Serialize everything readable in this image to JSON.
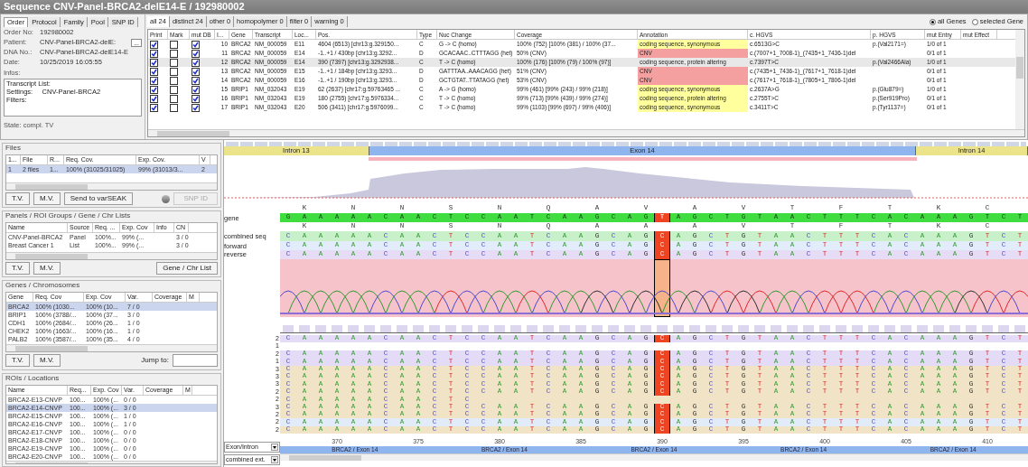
{
  "window": {
    "title": "Sequence CNV-Panel-BRCA2-delE14-E / 192980002"
  },
  "order_panel": {
    "tabs": [
      {
        "label": "Order",
        "selected": true
      },
      {
        "label": "Protocol",
        "selected": false
      },
      {
        "label": "Family",
        "selected": false
      },
      {
        "label": "Pool",
        "selected": false
      },
      {
        "label": "SNP ID",
        "selected": false
      }
    ],
    "fields": [
      {
        "label": "Order No:",
        "value": "192980002"
      },
      {
        "label": "Patient:",
        "value": "CNV-Panel-BRCA2-delE:",
        "button": "..."
      },
      {
        "label": "DNA No.:",
        "value": "CNV-Panel-BRCA2-delE14-E"
      },
      {
        "label": "Date:",
        "value": "10/25/2019 16:05:55"
      }
    ],
    "infos_label": "Infos:",
    "infos_lines": [
      "Transcript List:",
      "Settings:     CNV-Panel-BRCA2",
      "Filters:"
    ],
    "state": "State:  compl. TV"
  },
  "variant_tabs": [
    {
      "label": "all 24",
      "selected": true
    },
    {
      "label": "distinct 24",
      "selected": false
    },
    {
      "label": "other 0",
      "selected": false
    },
    {
      "label": "homopolymer 0",
      "selected": false
    },
    {
      "label": "filter 0",
      "selected": false
    },
    {
      "label": "warning 0",
      "selected": false
    }
  ],
  "gene_filter": [
    {
      "label": "all Genes",
      "selected": true
    },
    {
      "label": "selected Gene",
      "selected": false
    }
  ],
  "variant_table": {
    "columns": [
      "Print",
      "Mark",
      "mut DB",
      "I...",
      "Gene",
      "Transcript",
      "Loc...",
      "Pos.",
      "Type",
      "Nuc Change",
      "Coverage",
      "Annotation",
      "c. HGVS",
      "p. HGVS",
      "mut Entry",
      "mut Effect"
    ],
    "rows": [
      {
        "print": true,
        "mark": false,
        "mut_db": true,
        "index": "10",
        "gene": "BRCA2",
        "transcript": "NM_000059",
        "loc": "E11",
        "pos": "4604 (6513)  [chr13:g.329150...",
        "type": "C",
        "nuc_change": "G -> C (homo)",
        "coverage": "100% (752)  [100% (381) / 100% (37...",
        "annotation": {
          "text": "coding sequence, synonymous",
          "color": "#ffff9e"
        },
        "c_hgvs": "c.6513G>C",
        "p_hgvs": "p.(Val2171=)",
        "mut_entry": "1/0 of 1",
        "selected": false
      },
      {
        "print": true,
        "mark": false,
        "mut_db": true,
        "index": "11",
        "gene": "BRCA2",
        "transcript": "NM_000059",
        "loc": "E14",
        "pos": "-1..+1 / 430bp  [chr13:g.3292...",
        "type": "D",
        "nuc_change": "GCACAAC..CTTTAGG (het)",
        "coverage": "50% (CNV)",
        "annotation": {
          "text": "CNV",
          "color": "#f4a0a0"
        },
        "c_hgvs": "c.(7007+1_7008-1)_(7435+1_7436-1)del",
        "mut_entry": "0/1 of 1",
        "selected": false
      },
      {
        "print": true,
        "mark": false,
        "mut_db": true,
        "index": "12",
        "gene": "BRCA2",
        "transcript": "NM_000059",
        "loc": "E14",
        "pos": "390 (7397)  [chr13:g.3292938...",
        "type": "C",
        "nuc_change": "T -> C (homo)",
        "coverage": "100% (176)  [100% (79) / 100% (97)]",
        "annotation": {
          "text": "coding sequence, protein altering"
        },
        "c_hgvs": "c.7397T>C",
        "p_hgvs": "p.(Val2466Ala)",
        "mut_entry": "1/0 of 1",
        "selected": true
      },
      {
        "print": true,
        "mark": false,
        "mut_db": true,
        "index": "13",
        "gene": "BRCA2",
        "transcript": "NM_000059",
        "loc": "E15",
        "pos": "-1..+1 / 184bp  [chr13:g.3293...",
        "type": "D",
        "nuc_change": "GATTTAA..AAACAGG (het)",
        "coverage": "51% (CNV)",
        "annotation": {
          "text": "CNV",
          "color": "#f4a0a0"
        },
        "c_hgvs": "c.(7435+1_7436-1)_(7617+1_7618-1)del",
        "mut_entry": "0/1 of 1",
        "selected": false
      },
      {
        "print": true,
        "mark": false,
        "mut_db": true,
        "index": "14",
        "gene": "BRCA2",
        "transcript": "NM_000059",
        "loc": "E16",
        "pos": "-1..+1 / 190bp  [chr13:g.3293...",
        "type": "D",
        "nuc_change": "GCTGTAT..TTATAGG (het)",
        "coverage": "53% (CNV)",
        "annotation": {
          "text": "CNV",
          "color": "#f4a0a0"
        },
        "c_hgvs": "c.(7617+1_7618-1)_(7805+1_7806-1)del",
        "mut_entry": "0/1 of 1",
        "selected": false
      },
      {
        "print": true,
        "mark": false,
        "mut_db": true,
        "index": "15",
        "gene": "BRIP1",
        "transcript": "NM_032043",
        "loc": "E19",
        "pos": "62 (2637)  [chr17:g.59763465 ...",
        "type": "C",
        "nuc_change": "A -> G (homo)",
        "coverage": "99% (461)  [99% (243) / 99% (218)]",
        "annotation": {
          "text": "coding sequence, synonymous",
          "color": "#ffff9e"
        },
        "c_hgvs": "c.2637A>G",
        "p_hgvs": "p.(Glu879=)",
        "mut_entry": "1/0 of 1",
        "selected": false
      },
      {
        "print": true,
        "mark": false,
        "mut_db": true,
        "index": "16",
        "gene": "BRIP1",
        "transcript": "NM_032043",
        "loc": "E19",
        "pos": "180 (2755)  [chr17:g.5976334...",
        "type": "C",
        "nuc_change": "T -> C (homo)",
        "coverage": "99% (713)  [99% (439) / 99% (274)]",
        "annotation": {
          "text": "coding sequence, protein altering",
          "color": "#ffff9e"
        },
        "c_hgvs": "c.2755T>C",
        "p_hgvs": "p.(Ser919Pro)",
        "mut_entry": "0/1 of 1",
        "selected": false
      },
      {
        "print": true,
        "mark": false,
        "mut_db": true,
        "index": "17",
        "gene": "BRIP1",
        "transcript": "NM_032043",
        "loc": "E20",
        "pos": "506 (3411)  [chr17:g.5976099...",
        "type": "C",
        "nuc_change": "T -> C (homo)",
        "coverage": "99% (1103)  [99% (697) / 99% (406)]",
        "annotation": {
          "text": "coding sequence, synonymous",
          "color": "#ffff9e"
        },
        "c_hgvs": "c.3411T>C",
        "p_hgvs": "p.(Tyr1137=)",
        "mut_entry": "0/1 of 1",
        "selected": false
      }
    ]
  },
  "files": {
    "title": "Files",
    "columns": [
      "1...",
      "File",
      "R...",
      "Req. Cov.",
      "Exp. Cov.",
      "V"
    ],
    "rows": [
      {
        "cells": [
          "1",
          "2 files",
          "1...",
          "100% (31025/31025)",
          "99% (31013/3...",
          "2"
        ],
        "selected": true
      }
    ],
    "buttons": [
      "T.V.",
      "M.V.",
      "Send to varSEAK"
    ],
    "snp_button": {
      "label": "SNP ID",
      "disabled": true
    }
  },
  "panels": {
    "title": "Panels / ROI Groups / Gene / Chr Lists",
    "columns": [
      "Name",
      "Source",
      "Req. ...",
      "Exp. Cov",
      "Info",
      "CN"
    ],
    "rows": [
      {
        "cells": [
          "CNV-Panel-BRCA2",
          "Panel",
          "100%...",
          "99% (...",
          "",
          "3 / 0"
        ],
        "selected": false
      },
      {
        "cells": [
          "Breast Cancer 1",
          "List",
          "100%...",
          "99% (...",
          "",
          "3 / 0"
        ],
        "selected": false
      }
    ],
    "buttons": [
      "T.V.",
      "M.V."
    ],
    "right_button": "Gene / Chr List"
  },
  "genes": {
    "title": "Genes / Chromosomes",
    "columns": [
      "Gene",
      "Req. Cov",
      "Exp. Cov",
      "Var.",
      "Coverage",
      "M"
    ],
    "rows": [
      {
        "cells": [
          "BRCA2",
          "100% (1030...",
          "100% (10...",
          "7 / 0"
        ],
        "selected": true
      },
      {
        "cells": [
          "BRIP1",
          "100% (3788/...",
          "100% (37...",
          "3 / 0"
        ],
        "selected": false
      },
      {
        "cells": [
          "CDH1",
          "100% (2684/...",
          "100% (26...",
          "1 / 0"
        ],
        "selected": false
      },
      {
        "cells": [
          "CHEK2",
          "100% (1663/...",
          "100% (16...",
          "1 / 0"
        ],
        "selected": false
      },
      {
        "cells": [
          "PALB2",
          "100% (3587/...",
          "100% (35...",
          "4 / 0"
        ],
        "selected": false
      }
    ],
    "buttons": [
      "T.V.",
      "M.V."
    ],
    "jump_label": "Jump to:"
  },
  "rois": {
    "title": "ROIs / Locations",
    "columns": [
      "Name",
      "Req...",
      "Exp. Cov",
      "Var.",
      "Coverage",
      "M"
    ],
    "rows": [
      {
        "cells": [
          "BRCA2-E13-CNVP",
          "100...",
          "100% (...",
          "0 / 0"
        ],
        "selected": false
      },
      {
        "cells": [
          "BRCA2-E14-CNVP",
          "100...",
          "100% (...",
          "3 / 0"
        ],
        "selected": true
      },
      {
        "cells": [
          "BRCA2-E15-CNVP",
          "100...",
          "100% (...",
          "1 / 0"
        ],
        "selected": false
      },
      {
        "cells": [
          "BRCA2-E16-CNVP",
          "100...",
          "100% (...",
          "1 / 0"
        ],
        "selected": false
      },
      {
        "cells": [
          "BRCA2-E17-CNVP",
          "100...",
          "100% (...",
          "0 / 0"
        ],
        "selected": false
      },
      {
        "cells": [
          "BRCA2-E18-CNVP",
          "100...",
          "100% (...",
          "0 / 0"
        ],
        "selected": false
      },
      {
        "cells": [
          "BRCA2-E19-CNVP",
          "100...",
          "100% (...",
          "0 / 0"
        ],
        "selected": false
      },
      {
        "cells": [
          "BRCA2-E20-CNVP",
          "100...",
          "100% (...",
          "0 / 0"
        ],
        "selected": false
      }
    ]
  },
  "overview": {
    "regions": [
      {
        "label": "Intron 13",
        "kind": "intron"
      },
      {
        "label": "Exon 14",
        "kind": "exon"
      },
      {
        "label": "Intron 14",
        "kind": "intron"
      }
    ]
  },
  "sequence": {
    "labels": [
      "gene",
      "combined seq",
      "forward",
      "reverse"
    ],
    "gene_protein": [
      "K",
      "N",
      "N",
      "S",
      "N",
      "Q",
      "A",
      "V",
      "A",
      "V",
      "T",
      "F",
      "T",
      "K",
      "C"
    ],
    "combined_protein": [
      "K",
      "N",
      "N",
      "S",
      "N",
      "Q",
      "A",
      "A",
      "A",
      "V",
      "T",
      "F",
      "T",
      "K",
      "C"
    ],
    "gene": {
      "before": "G A A A A A C A A C T C C A A T C A A G C A G",
      "variant": "T",
      "after": "A G C T G T A A C T T T C A C A A A G T C T"
    },
    "combined": {
      "before": "C A A A A A C A A C T C C A A T C A A G C A G",
      "variant": "C",
      "after": "A G C T G T A A C T T T C A C A A A G T C T"
    },
    "forward": {
      "before": "C A A A A A C A A C T C C A A T C A A G C A G",
      "variant": "C",
      "after": "A G C T G T A A C T T T C A C A A A G T C T"
    },
    "reverse": {
      "before": "C A A A A A C A A C T C C A A T C A A G C A G",
      "variant": "C",
      "after": "A G C T G T A A C T T T C A C A A A G T C T"
    },
    "reads": [
      {
        "count": "2",
        "color": "#e4dcf6",
        "before": "C A A A A A C A A C T C C A A T C A A G C A G",
        "variant": "C",
        "after": "A G C T G T A A C T T T C A C A A A G T C T"
      },
      {
        "count": "1"
      },
      {
        "count": "2",
        "color": "#e4dcf6",
        "before": "C A A A A A C A A C T C C A A T C A A G C A G",
        "variant": "C",
        "after": "A G C T G T A A C T T T C A C A A A G T C T"
      },
      {
        "count": "1",
        "color": "#e4dcf6",
        "before": "C A A A A A C A A C T C C A A T C A A G C A G",
        "variant": "C",
        "after": "A G C T G T A A C T T T C A C A A A G T C T"
      },
      {
        "count": "3",
        "color": "#f1e4c6",
        "before": "C A A A A A C A A C T C C A A T C A A G C A G",
        "variant": "C",
        "after": "A G C T G T A A C T T T C A C A A A G T C T"
      },
      {
        "count": "3",
        "color": "#f1e4c6",
        "before": "C A A A A A C A A C T C C A A T C A A G C A G",
        "variant": "C",
        "after": "A G C T G T A A C T T T C A C A A A G T C T"
      },
      {
        "count": "3",
        "color": "#f1e4c6",
        "before": "C A A A A A C A A C T C C A A T C A A G C A G",
        "variant": "C",
        "after": "A G C T G T A A C T T T C A C A A A G T C T"
      },
      {
        "count": "2",
        "color": "#f1e4c6",
        "before": "C A A A A A C A A C T C C A A T C A A G C A G",
        "variant": "C",
        "after": "A G C T G T A A C T T T C A C A A A G T C T"
      },
      {
        "count": "2",
        "color": "#f1e4c6",
        "before": "C A A A A A C A A C T C"
      },
      {
        "count": "3",
        "color": "#f1e4c6",
        "before": "C A A A A A C A A C T C C A A T C A A G C A G",
        "variant": "C",
        "after": "A G C T G T A A C T T T C A C A A A G T C T"
      },
      {
        "count": "2",
        "color": "#f1e4c6",
        "before": "C A A A A A C A A C T C C A A T C A A G C A G",
        "variant": "C",
        "after": "A G C T G T A A C T T T C A C A A A G T C T"
      },
      {
        "count": "2",
        "color": "#e2ecf8",
        "before": "C A A A A A C A A C T C C A A T C A A G C A G",
        "variant": "C",
        "after": "A G C T G T A A C T T T C A C A A A G T C T"
      },
      {
        "count": "2",
        "color": "#f1e4c6",
        "before": "C A A A A A C A A C T C C A A T C A A G C A G",
        "variant": "C",
        "after": "A G C T G T A A C T T T C A C A A A G T C T"
      }
    ],
    "ruler": [
      "370",
      "375",
      "380",
      "385",
      "390",
      "395",
      "400",
      "405",
      "410"
    ],
    "exon_labels": [
      "BRCA2 / Exon 14",
      "BRCA2 / Exon 14",
      "BRCA2 / Exon 14",
      "BRCA2 / Exon 14",
      "BRCA2 / Exon 14"
    ],
    "dropdowns": [
      "Exon/Intron",
      "combined ext."
    ]
  }
}
